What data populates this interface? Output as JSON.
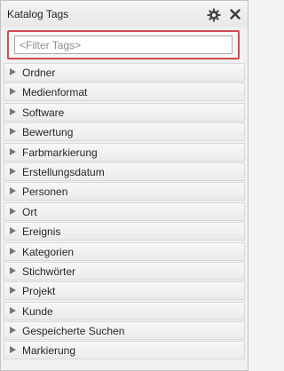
{
  "panel": {
    "title": "Katalog Tags",
    "icons": {
      "settings": "gear-icon",
      "close": "close-icon"
    },
    "accent_color": "#d64a4f"
  },
  "filter": {
    "placeholder": "<Filter Tags>",
    "value": ""
  },
  "categories": [
    "Ordner",
    "Medienformat",
    "Software",
    "Bewertung",
    "Farbmarkierung",
    "Erstellungsdatum",
    "Personen",
    "Ort",
    "Ereignis",
    "Kategorien",
    "Stichwörter",
    "Projekt",
    "Kunde",
    "Gespeicherte Suchen",
    "Markierung"
  ]
}
